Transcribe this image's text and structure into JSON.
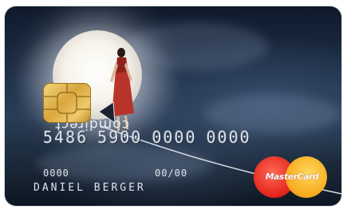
{
  "card": {
    "brand_name": "comdirect",
    "number_groups": [
      "5486",
      "5900",
      "0000",
      "0000"
    ],
    "line_code": "0000",
    "expiry": "00/00",
    "cardholder": "DANIEL BERGER",
    "network_label": "MasterCard",
    "network": "mastercard"
  },
  "colors": {
    "night_sky": "#1f3048",
    "moon": "#f6f3ea",
    "chip_gold": "#d8a63d",
    "dress_red": "#b8342a",
    "mc_red": "#e2231a",
    "mc_yellow": "#f6a81c",
    "embossed_text": "#dde3ea"
  },
  "icons": {
    "chip": "emv-chip-icon",
    "network_logo": "mastercard-logo-icon"
  }
}
